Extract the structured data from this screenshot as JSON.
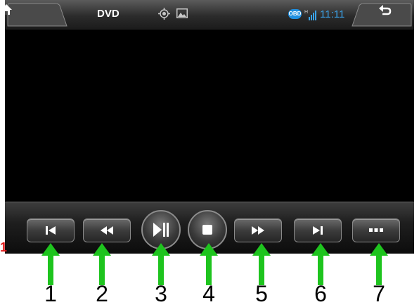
{
  "topbar": {
    "title": "DVD",
    "obd_badge": "OBD",
    "signal_label": "H",
    "clock": "11:11",
    "icons": [
      "home-icon",
      "gps-icon",
      "photo-icon",
      "obd-icon",
      "signal-icon",
      "back-icon"
    ]
  },
  "controls": [
    {
      "name": "previous-track-button",
      "icon": "previous-track-icon"
    },
    {
      "name": "rewind-button",
      "icon": "rewind-icon"
    },
    {
      "name": "play-pause-button",
      "icon": "play-pause-icon"
    },
    {
      "name": "stop-button",
      "icon": "stop-icon"
    },
    {
      "name": "fast-forward-button",
      "icon": "fast-forward-icon"
    },
    {
      "name": "next-track-button",
      "icon": "next-track-icon"
    },
    {
      "name": "more-button",
      "icon": "more-icon"
    }
  ],
  "annotations": {
    "corner_mark": "1",
    "labels": [
      "1",
      "2",
      "3",
      "4",
      "5",
      "6",
      "7"
    ],
    "arrow_color": "#1ec41e"
  },
  "colors": {
    "accent_blue": "#3aa3ea",
    "screen_bg": "#000000"
  }
}
